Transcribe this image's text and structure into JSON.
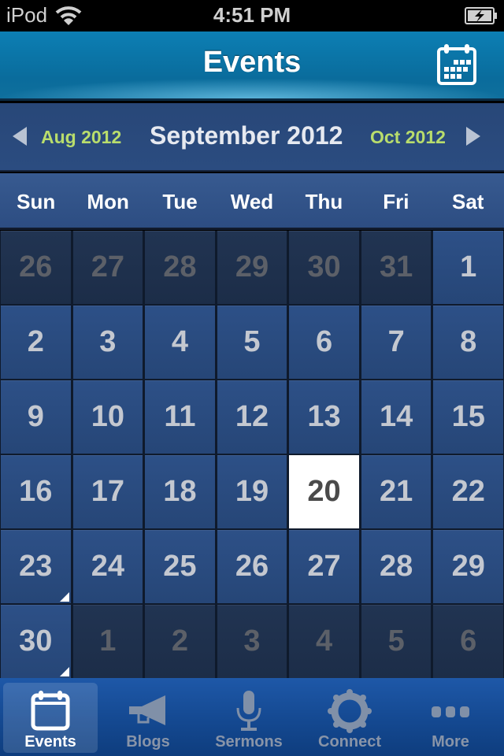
{
  "status_bar": {
    "carrier": "iPod",
    "time": "4:51 PM",
    "wifi_icon": "wifi-icon",
    "battery_icon": "battery-charging-icon"
  },
  "nav_bar": {
    "title": "Events",
    "right_button_icon": "calendar-icon"
  },
  "month_nav": {
    "prev_label": "Aug 2012",
    "current": "September 2012",
    "next_label": "Oct 2012",
    "prev_icon": "triangle-left-icon",
    "next_icon": "triangle-right-icon"
  },
  "weekdays": [
    "Sun",
    "Mon",
    "Tue",
    "Wed",
    "Thu",
    "Fri",
    "Sat"
  ],
  "calendar": {
    "selected_day": "20",
    "days": [
      {
        "label": "26",
        "in_month": false,
        "today": false,
        "has_event": false
      },
      {
        "label": "27",
        "in_month": false,
        "today": false,
        "has_event": false
      },
      {
        "label": "28",
        "in_month": false,
        "today": false,
        "has_event": false
      },
      {
        "label": "29",
        "in_month": false,
        "today": false,
        "has_event": false
      },
      {
        "label": "30",
        "in_month": false,
        "today": false,
        "has_event": false
      },
      {
        "label": "31",
        "in_month": false,
        "today": false,
        "has_event": false
      },
      {
        "label": "1",
        "in_month": true,
        "today": false,
        "has_event": false
      },
      {
        "label": "2",
        "in_month": true,
        "today": false,
        "has_event": false
      },
      {
        "label": "3",
        "in_month": true,
        "today": false,
        "has_event": false
      },
      {
        "label": "4",
        "in_month": true,
        "today": false,
        "has_event": false
      },
      {
        "label": "5",
        "in_month": true,
        "today": false,
        "has_event": false
      },
      {
        "label": "6",
        "in_month": true,
        "today": false,
        "has_event": false
      },
      {
        "label": "7",
        "in_month": true,
        "today": false,
        "has_event": false
      },
      {
        "label": "8",
        "in_month": true,
        "today": false,
        "has_event": false
      },
      {
        "label": "9",
        "in_month": true,
        "today": false,
        "has_event": false
      },
      {
        "label": "10",
        "in_month": true,
        "today": false,
        "has_event": false
      },
      {
        "label": "11",
        "in_month": true,
        "today": false,
        "has_event": false
      },
      {
        "label": "12",
        "in_month": true,
        "today": false,
        "has_event": false
      },
      {
        "label": "13",
        "in_month": true,
        "today": false,
        "has_event": false
      },
      {
        "label": "14",
        "in_month": true,
        "today": false,
        "has_event": false
      },
      {
        "label": "15",
        "in_month": true,
        "today": false,
        "has_event": false
      },
      {
        "label": "16",
        "in_month": true,
        "today": false,
        "has_event": false
      },
      {
        "label": "17",
        "in_month": true,
        "today": false,
        "has_event": false
      },
      {
        "label": "18",
        "in_month": true,
        "today": false,
        "has_event": false
      },
      {
        "label": "19",
        "in_month": true,
        "today": false,
        "has_event": false
      },
      {
        "label": "20",
        "in_month": true,
        "today": true,
        "has_event": false
      },
      {
        "label": "21",
        "in_month": true,
        "today": false,
        "has_event": false
      },
      {
        "label": "22",
        "in_month": true,
        "today": false,
        "has_event": false
      },
      {
        "label": "23",
        "in_month": true,
        "today": false,
        "has_event": true
      },
      {
        "label": "24",
        "in_month": true,
        "today": false,
        "has_event": false
      },
      {
        "label": "25",
        "in_month": true,
        "today": false,
        "has_event": false
      },
      {
        "label": "26",
        "in_month": true,
        "today": false,
        "has_event": false
      },
      {
        "label": "27",
        "in_month": true,
        "today": false,
        "has_event": false
      },
      {
        "label": "28",
        "in_month": true,
        "today": false,
        "has_event": false
      },
      {
        "label": "29",
        "in_month": true,
        "today": false,
        "has_event": false
      },
      {
        "label": "30",
        "in_month": true,
        "today": false,
        "has_event": true
      },
      {
        "label": "1",
        "in_month": false,
        "today": false,
        "has_event": false
      },
      {
        "label": "2",
        "in_month": false,
        "today": false,
        "has_event": false
      },
      {
        "label": "3",
        "in_month": false,
        "today": false,
        "has_event": false
      },
      {
        "label": "4",
        "in_month": false,
        "today": false,
        "has_event": false
      },
      {
        "label": "5",
        "in_month": false,
        "today": false,
        "has_event": false
      },
      {
        "label": "6",
        "in_month": false,
        "today": false,
        "has_event": false
      }
    ]
  },
  "tab_bar": {
    "items": [
      {
        "label": "Events",
        "icon": "calendar-icon",
        "active": true
      },
      {
        "label": "Blogs",
        "icon": "megaphone-icon",
        "active": false
      },
      {
        "label": "Sermons",
        "icon": "microphone-icon",
        "active": false
      },
      {
        "label": "Connect",
        "icon": "people-circle-icon",
        "active": false
      },
      {
        "label": "More",
        "icon": "more-dots-icon",
        "active": false
      }
    ]
  },
  "colors": {
    "nav_blue": "#0a6c9c",
    "calendar_blue": "#2d5087",
    "other_month": "#1f3150",
    "adjacent_month_label": "#b9dd6c",
    "today_bg": "#ffffff"
  }
}
